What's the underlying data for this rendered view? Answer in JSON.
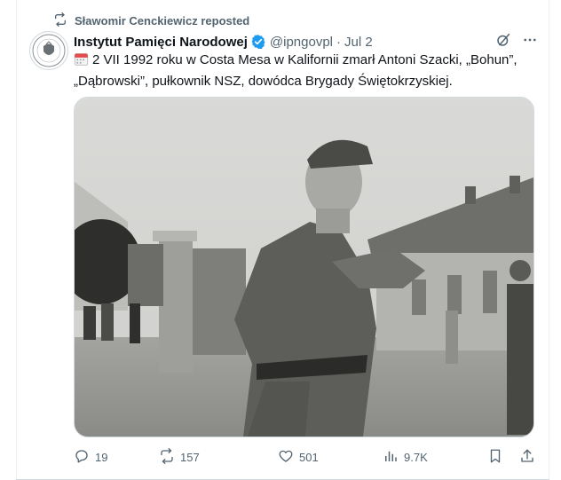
{
  "repost": {
    "label": "Sławomir Cenckiewicz reposted"
  },
  "post": {
    "author_name": "Instytut Pamięci Narodowej",
    "handle": "@ipngovpl",
    "separator": "·",
    "date": "Jul 2",
    "text_line1": "2 VII 1992 roku w Costa Mesa w Kalifornii zmarł Antoni Szacki, „Bohun”,",
    "text_line2": "„Dąbrowski”, pułkownik NSZ, dowódca Brygady Świętokrzyskiej.",
    "calendar_icon": "calendar-icon",
    "verified_icon": "verified-badge-icon"
  },
  "actions": {
    "replies": "19",
    "reposts": "157",
    "likes": "501",
    "views": "9.7K"
  },
  "colors": {
    "secondary_text": "#536471",
    "verified_blue": "#1d9bf0",
    "border": "#cfd9de"
  }
}
